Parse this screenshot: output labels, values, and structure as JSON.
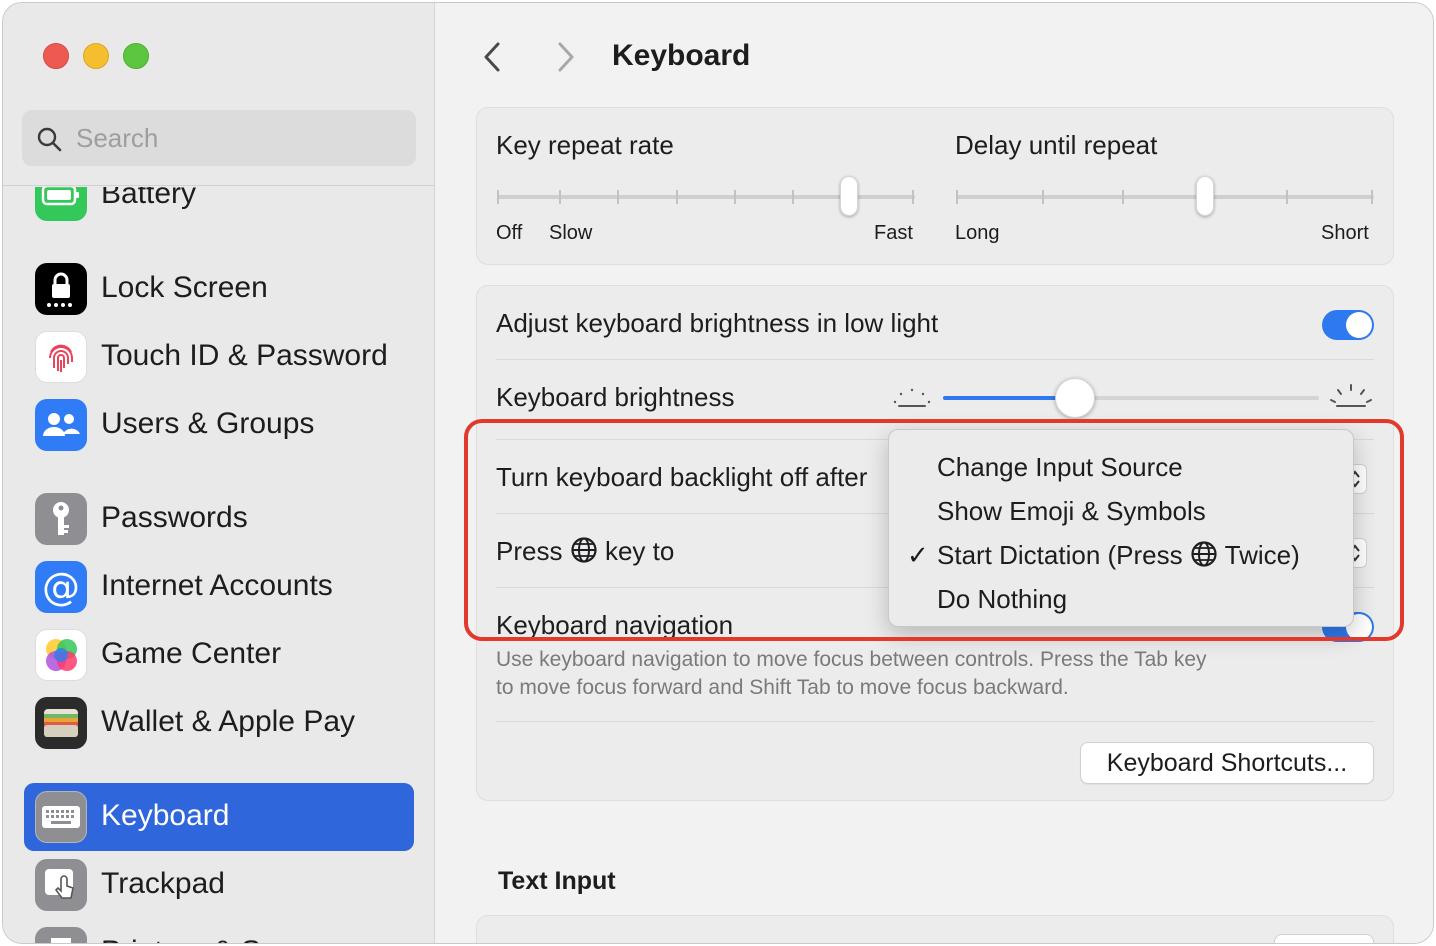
{
  "window": {
    "traffic_lights": {
      "close_color": "#ee5a52",
      "minimize_color": "#f5be2f",
      "zoom_color": "#5dc640"
    }
  },
  "sidebar": {
    "search": {
      "placeholder": "Search",
      "icon": "magnifying-glass-icon"
    },
    "items": [
      {
        "label": "Battery",
        "icon": "battery-icon",
        "icon_color": "#34c759",
        "selected": false
      },
      {
        "label": "Lock Screen",
        "icon": "lock-icon",
        "icon_color": "#000000",
        "selected": false
      },
      {
        "label": "Touch ID & Password",
        "icon": "fingerprint-icon",
        "icon_color": "#ffffff",
        "selected": false
      },
      {
        "label": "Users & Groups",
        "icon": "users-icon",
        "icon_color": "#2f7cf6",
        "selected": false
      },
      {
        "label": "Passwords",
        "icon": "key-icon",
        "icon_color": "#8e8e93",
        "selected": false
      },
      {
        "label": "Internet Accounts",
        "icon": "at-icon",
        "icon_color": "#2f7cf6",
        "selected": false
      },
      {
        "label": "Game Center",
        "icon": "game-center-icon",
        "icon_color": "#ffffff",
        "selected": false
      },
      {
        "label": "Wallet & Apple Pay",
        "icon": "wallet-icon",
        "icon_color": "#2b2b2b",
        "selected": false
      },
      {
        "label": "Keyboard",
        "icon": "keyboard-icon",
        "icon_color": "#8e8e93",
        "selected": true
      },
      {
        "label": "Trackpad",
        "icon": "trackpad-icon",
        "icon_color": "#8e8e93",
        "selected": false
      },
      {
        "label": "Printers & Scanners",
        "icon": "printer-icon",
        "icon_color": "#8e8e93",
        "selected": false
      }
    ],
    "selected_color": "#2f66db"
  },
  "header": {
    "title": "Keyboard",
    "back_icon": "chevron-left-icon",
    "forward_icon": "chevron-right-icon"
  },
  "key_repeat": {
    "label": "Key repeat rate",
    "labels": {
      "off": "Off",
      "slow": "Slow",
      "fast": "Fast"
    },
    "position": 6,
    "stops": 8
  },
  "delay_repeat": {
    "label": "Delay until repeat",
    "labels": {
      "long": "Long",
      "short": "Short"
    },
    "position": 4,
    "stops": 6
  },
  "brightness_auto": {
    "label": "Adjust keyboard brightness in low light",
    "enabled": true
  },
  "brightness": {
    "label": "Keyboard brightness",
    "level": 0.35,
    "low_icon": "brightness-low-icon",
    "high_icon": "brightness-high-icon"
  },
  "backlight_off": {
    "label": "Turn keyboard backlight off after"
  },
  "press_globe": {
    "label_before": "Press",
    "label_after": "key to",
    "globe_icon": "globe-icon"
  },
  "keyboard_nav": {
    "label": "Keyboard navigation",
    "enabled": true,
    "description_line1": "Use keyboard navigation to move focus between controls. Press the Tab key",
    "description_line2": "to move focus forward and Shift Tab to move focus backward."
  },
  "shortcuts_button": "Keyboard Shortcuts...",
  "text_input": {
    "title": "Text Input"
  },
  "popup_menu": {
    "items": [
      {
        "label": "Change Input Source",
        "checked": false
      },
      {
        "label": "Show Emoji & Symbols",
        "checked": false
      },
      {
        "label_before": "Start Dictation (Press",
        "label_after": "Twice)",
        "checked": true
      },
      {
        "label": "Do Nothing",
        "checked": false
      }
    ],
    "check_glyph": "✓"
  },
  "accent_color": "#2f79f0",
  "highlight_color": "#e1392b"
}
